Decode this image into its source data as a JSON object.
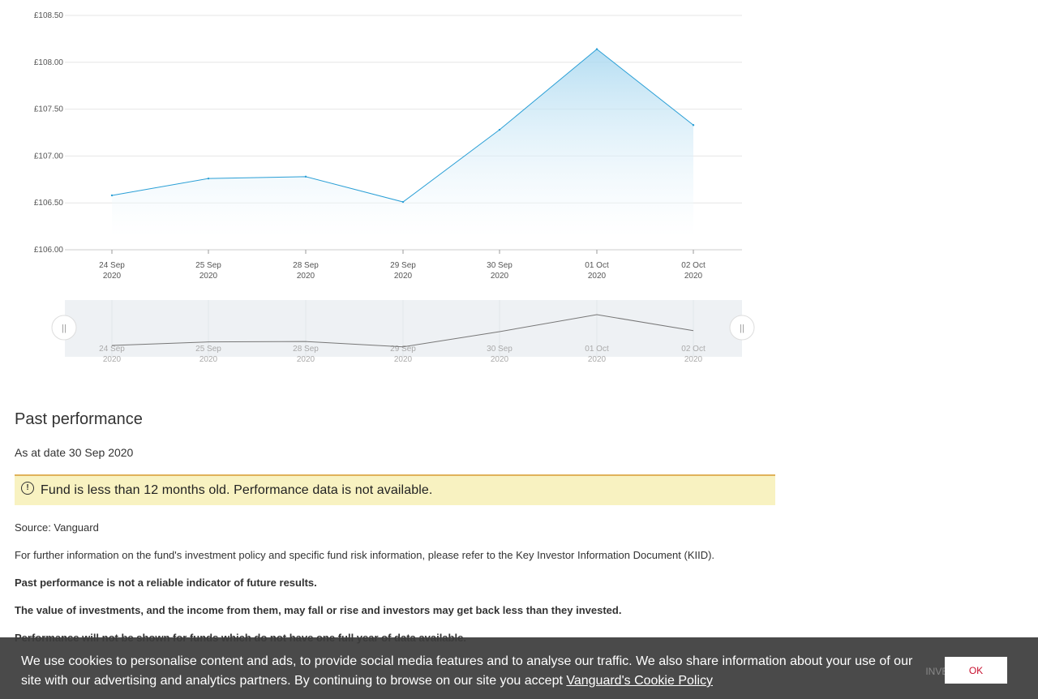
{
  "chart_data": {
    "type": "area",
    "x": [
      "24 Sep 2020",
      "25 Sep 2020",
      "28 Sep 2020",
      "29 Sep 2020",
      "30 Sep 2020",
      "01 Oct 2020",
      "02 Oct 2020"
    ],
    "x_tick_labels": [
      {
        "day": "24 Sep",
        "year": "2020"
      },
      {
        "day": "25 Sep",
        "year": "2020"
      },
      {
        "day": "28 Sep",
        "year": "2020"
      },
      {
        "day": "29 Sep",
        "year": "2020"
      },
      {
        "day": "30 Sep",
        "year": "2020"
      },
      {
        "day": "01 Oct",
        "year": "2020"
      },
      {
        "day": "02 Oct",
        "year": "2020"
      }
    ],
    "values": [
      106.58,
      106.76,
      106.78,
      106.51,
      107.28,
      108.14,
      107.33
    ],
    "ylim": [
      106.0,
      108.5
    ],
    "y_ticks": [
      "£108.50",
      "£108.00",
      "£107.50",
      "£107.00",
      "£106.50",
      "£106.00"
    ],
    "y_tick_values": [
      108.5,
      108.0,
      107.5,
      107.0,
      106.5,
      106.0
    ],
    "grid": true,
    "line_color": "#2a9fd6",
    "navigator": true
  },
  "navigator": {
    "left_handle": "||",
    "right_handle": "||"
  },
  "past_performance": {
    "title": "Past performance",
    "as_at": "As at date 30 Sep 2020",
    "warning_icon": "info-circle-icon",
    "warning": "Fund is less than 12 months old. Performance data is not available.",
    "source": "Source: Vanguard",
    "further_info": "For further information on the fund's investment policy and specific fund risk information, please refer to the Key Investor Information Document (KIID).",
    "disclaimer_1": "Past performance is not a reliable indicator of future results.",
    "disclaimer_2": "The value of investments, and the income from them, may fall or rise and investors may get back less than they invested.",
    "disclaimer_3": "Performance will not be shown for funds which do not have one full year of data available."
  },
  "cookie": {
    "text": "We use cookies to personalise content and ads, to provide social media features and to analyse our traffic. We also share information about your use of our site with our advertising and analytics partners. By continuing to browse on our site you accept ",
    "link": "Vanguard's Cookie Policy",
    "ghost_button": "INVEST",
    "ok": "OK",
    "ok_color": "#c8102e"
  }
}
